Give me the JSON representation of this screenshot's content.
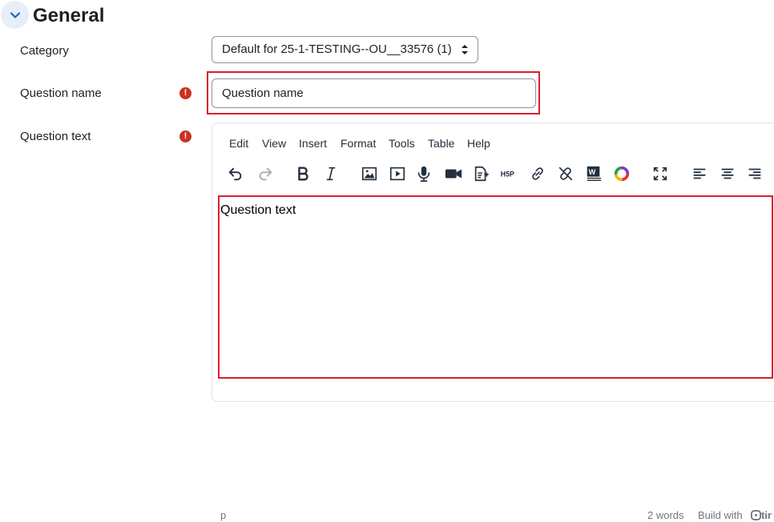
{
  "section": {
    "title": "General",
    "toggle_icon": "chevron-down-icon"
  },
  "fields": {
    "category": {
      "label": "Category",
      "selected": "Default for 25-1-TESTING--OU__33576 (1)"
    },
    "question_name": {
      "label": "Question name",
      "required_icon": "!",
      "placeholder": "Question name",
      "value": ""
    },
    "question_text": {
      "label": "Question text",
      "required_icon": "!"
    }
  },
  "editor": {
    "menu": [
      "Edit",
      "View",
      "Insert",
      "Format",
      "Tools",
      "Table",
      "Help"
    ],
    "toolbar": [
      "undo-icon",
      "redo-icon",
      "bold-icon",
      "italic-icon",
      "image-icon",
      "media-icon",
      "microphone-icon",
      "video-icon",
      "ai-generate-icon",
      "h5p-icon",
      "link-icon",
      "unlink-icon",
      "word-import-icon",
      "color-wheel-icon",
      "fullscreen-icon",
      "align-left-icon",
      "align-center-icon",
      "align-right-icon"
    ],
    "h5p_label": "H5P",
    "content": "Question text",
    "status": {
      "path": "p",
      "word_count": "2 words",
      "branding": "Build with",
      "brand_fragment": "tir"
    }
  },
  "colors": {
    "required": "#ca3120",
    "highlight": "#d9202b",
    "toggle_bg": "#e8eef7"
  }
}
